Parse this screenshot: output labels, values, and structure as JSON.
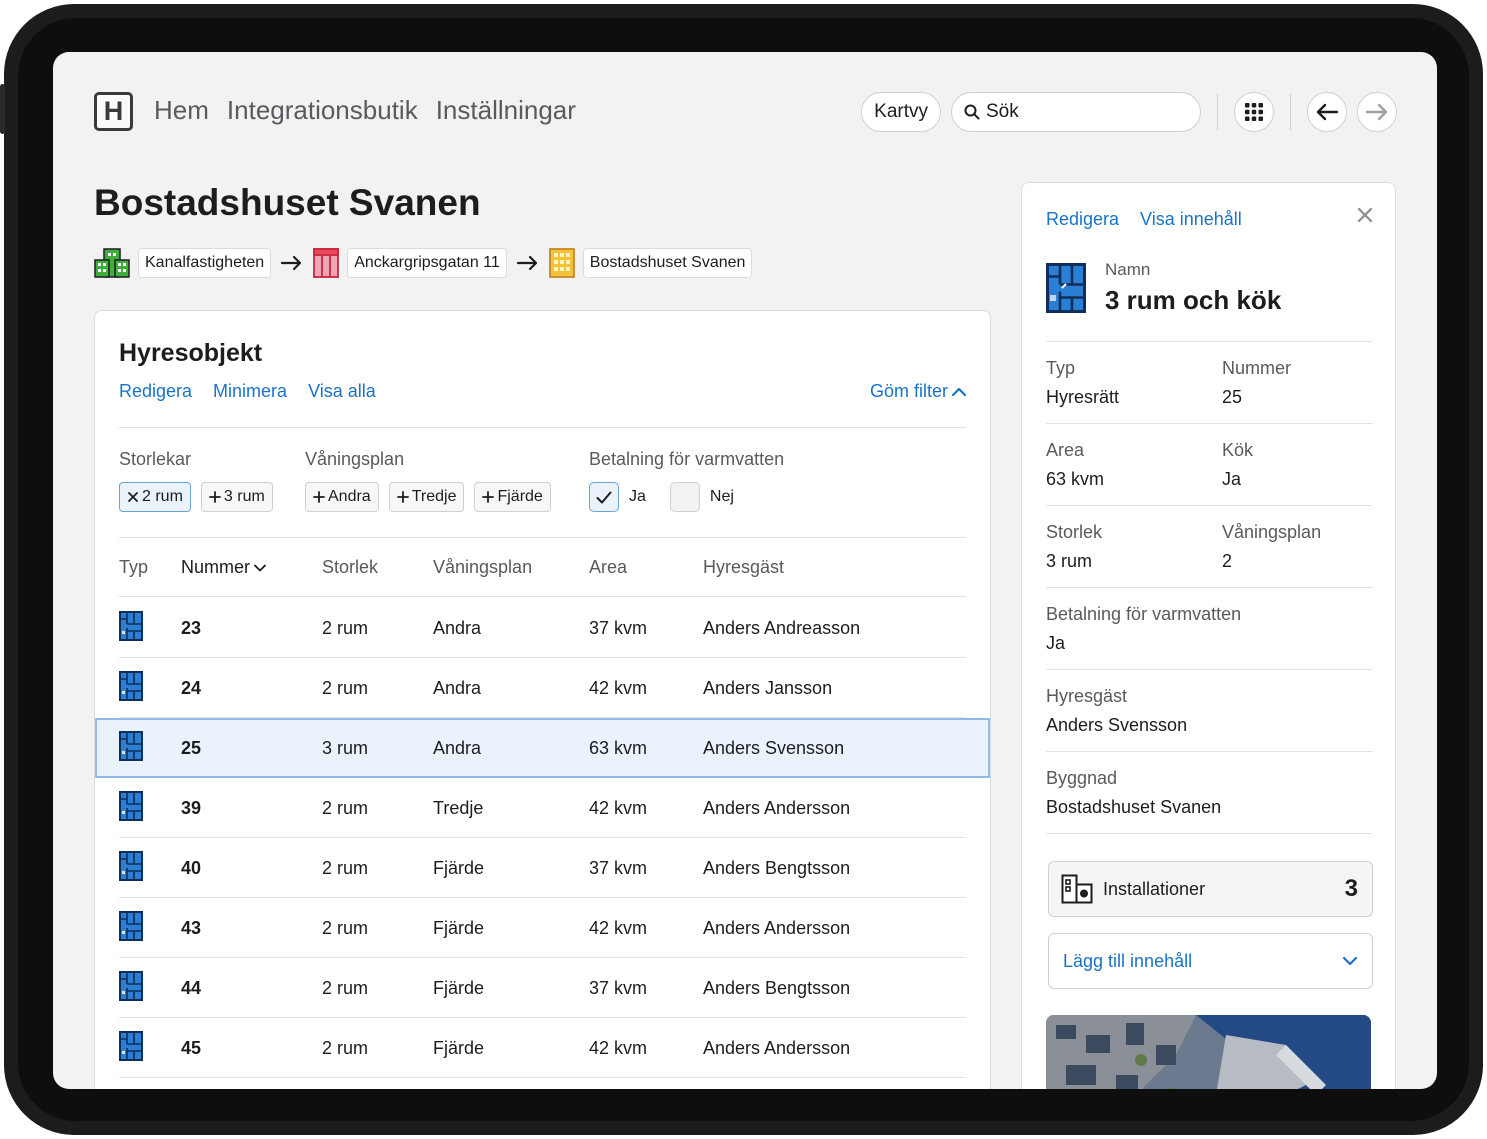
{
  "nav": {
    "items": [
      "Hem",
      "Integrationsbutik",
      "Inställningar"
    ]
  },
  "toolbar": {
    "map_view_label": "Kartvy",
    "search_placeholder": "Sök"
  },
  "page": {
    "title": "Bostadshuset Svanen"
  },
  "breadcrumb": [
    "Kanalfastigheten",
    "Anckargripsgatan 11",
    "Bostadshuset Svanen"
  ],
  "rental_objects": {
    "title": "Hyresobjekt",
    "actions": [
      "Redigera",
      "Minimera",
      "Visa alla"
    ],
    "hide_filter_label": "Göm filter",
    "filters": {
      "sizes": {
        "label": "Storlekar",
        "chips": [
          "2 rum",
          "3 rum"
        ]
      },
      "floors": {
        "label": "Våningsplan",
        "chips": [
          "Andra",
          "Tredje",
          "Fjärde"
        ]
      },
      "hot_water": {
        "label": "Betalning för varmvatten",
        "yes": "Ja",
        "no": "Nej"
      }
    },
    "columns": [
      "Typ",
      "Nummer",
      "Storlek",
      "Våningsplan",
      "Area",
      "Hyresgäst"
    ],
    "rows": [
      {
        "number": "23",
        "size": "2 rum",
        "floor": "Andra",
        "area": "37 kvm",
        "tenant": "Anders Andreasson"
      },
      {
        "number": "24",
        "size": "2 rum",
        "floor": "Andra",
        "area": "42 kvm",
        "tenant": "Anders Jansson"
      },
      {
        "number": "25",
        "size": "3 rum",
        "floor": "Andra",
        "area": "63 kvm",
        "tenant": "Anders Svensson"
      },
      {
        "number": "39",
        "size": "2 rum",
        "floor": "Tredje",
        "area": "42 kvm",
        "tenant": "Anders Andersson"
      },
      {
        "number": "40",
        "size": "2 rum",
        "floor": "Fjärde",
        "area": "37 kvm",
        "tenant": "Anders Bengtsson"
      },
      {
        "number": "43",
        "size": "2 rum",
        "floor": "Fjärde",
        "area": "42 kvm",
        "tenant": "Anders Andersson"
      },
      {
        "number": "44",
        "size": "2 rum",
        "floor": "Fjärde",
        "area": "37 kvm",
        "tenant": "Anders Bengtsson"
      },
      {
        "number": "45",
        "size": "2 rum",
        "floor": "Fjärde",
        "area": "42 kvm",
        "tenant": "Anders Andersson"
      }
    ]
  },
  "details": {
    "actions": [
      "Redigera",
      "Visa innehåll"
    ],
    "name_label": "Namn",
    "name_value": "3 rum och kök",
    "fields": {
      "type": {
        "label": "Typ",
        "value": "Hyresrätt"
      },
      "number": {
        "label": "Nummer",
        "value": "25"
      },
      "area": {
        "label": "Area",
        "value": "63 kvm"
      },
      "kitchen": {
        "label": "Kök",
        "value": "Ja"
      },
      "size": {
        "label": "Storlek",
        "value": "3 rum"
      },
      "floor": {
        "label": "Våningsplan",
        "value": "2"
      },
      "hot_water": {
        "label": "Betalning för varmvatten",
        "value": "Ja"
      },
      "tenant": {
        "label": "Hyresgäst",
        "value": "Anders Svensson"
      },
      "building": {
        "label": "Byggnad",
        "value": "Bostadshuset Svanen"
      }
    },
    "installations_label": "Installationer",
    "installations_count": "3",
    "add_content_label": "Lägg till innehåll"
  },
  "colors": {
    "accent": "#1a73c8",
    "selected_row": "#eaf3fc",
    "icon_blue": "#2a7fd4"
  }
}
